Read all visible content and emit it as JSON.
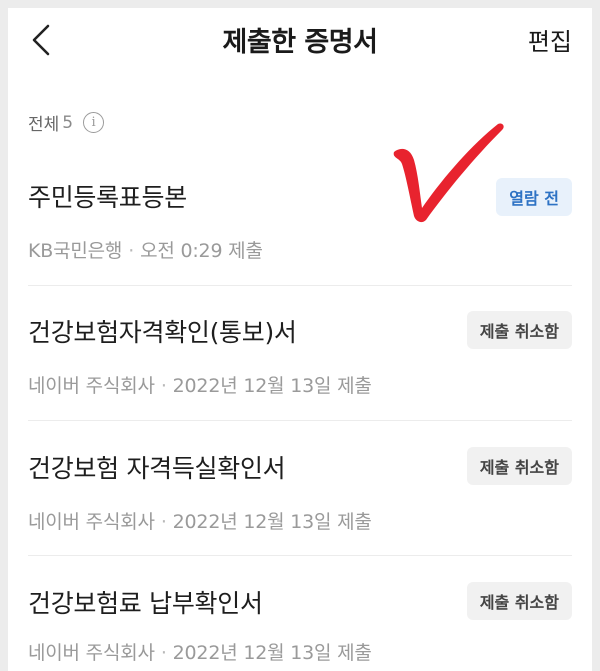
{
  "header": {
    "title": "제출한 증명서",
    "edit_label": "편집"
  },
  "summary": {
    "label": "전체",
    "count": "5",
    "info_glyph": "i"
  },
  "documents": [
    {
      "title": "주민등록표등본",
      "issuer": "KB국민은행",
      "datetime": "오전 0:29 제출",
      "status": "열람 전"
    },
    {
      "title": "건강보험자격확인(통보)서",
      "issuer": "네이버 주식회사",
      "datetime": "2022년 12월 13일 제출",
      "status": "제출 취소함"
    },
    {
      "title": "건강보험 자격득실확인서",
      "issuer": "네이버 주식회사",
      "datetime": "2022년 12월 13일 제출",
      "status": "제출 취소함"
    },
    {
      "title": "건강보험료 납부확인서",
      "issuer": "네이버 주식회사",
      "datetime": "2022년 12월 13일 제출",
      "status": "제출 취소함"
    }
  ],
  "colors": {
    "unread_badge_bg": "#e8f1fb",
    "unread_badge_text": "#2d72c4",
    "cancel_badge_bg": "#f1f1f1",
    "check_mark": "#e8232e"
  }
}
